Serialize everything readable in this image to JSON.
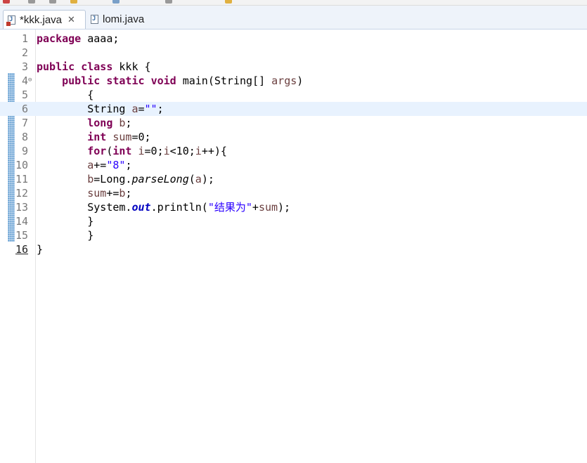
{
  "tabs": [
    {
      "label": "*kkk.java",
      "active": true,
      "closable": true,
      "icon": "java-file-error-icon"
    },
    {
      "label": "lomi.java",
      "active": false,
      "icon": "java-file-icon"
    }
  ],
  "editor": {
    "current_line": 6,
    "lines": [
      {
        "n": "1",
        "code": "package aaaa;"
      },
      {
        "n": "2",
        "code": ""
      },
      {
        "n": "3",
        "code": "public class kkk {"
      },
      {
        "n": "4",
        "code": "\tpublic static void main(String[] args)"
      },
      {
        "n": "5",
        "code": "\t\t{"
      },
      {
        "n": "6",
        "code": "\t\tString a=\"\";"
      },
      {
        "n": "7",
        "code": "\t\tlong b;"
      },
      {
        "n": "8",
        "code": "\t\tint sum=0;"
      },
      {
        "n": "9",
        "code": "\t\tfor(int i=0;i<10;i++){"
      },
      {
        "n": "10",
        "code": "\t\ta+=\"8\";"
      },
      {
        "n": "11",
        "code": "\t\tb=Long.parseLong(a);"
      },
      {
        "n": "12",
        "code": "\t\tsum+=b;"
      },
      {
        "n": "13",
        "code": "\t\tSystem.out.println(\"结果为\"+sum);"
      },
      {
        "n": "14",
        "code": "\t\t}"
      },
      {
        "n": "15",
        "code": "\t\t}"
      },
      {
        "n": "16",
        "code": "}"
      }
    ]
  },
  "colors": {
    "keyword": "#7f0055",
    "string": "#2a00ff",
    "variable": "#6a3e3e",
    "field": "#0000c0",
    "current_line": "#e8f2fe"
  }
}
